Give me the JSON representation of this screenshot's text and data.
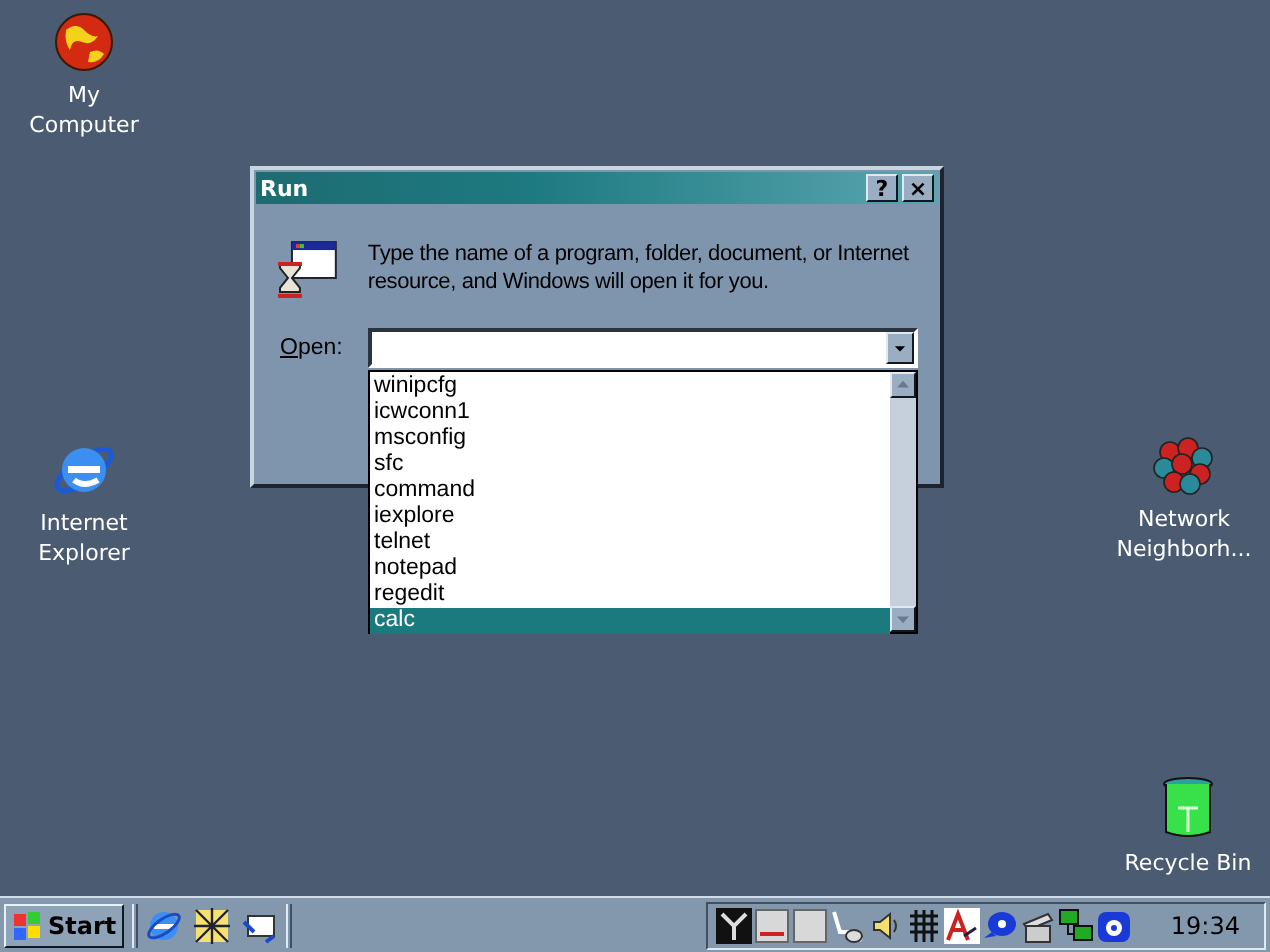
{
  "desktop_icons": [
    {
      "label": "My Computer",
      "kind": "globe"
    },
    {
      "label": "Internet Explorer",
      "kind": "ie"
    },
    {
      "label": "Network Neighborh...",
      "kind": "cluster"
    },
    {
      "label": "Recycle Bin",
      "kind": "beaker"
    }
  ],
  "window": {
    "title": "Run",
    "message": "Type the name of a program, folder, document, or Internet resource, and Windows will open it for you.",
    "help_button": "?",
    "close_button": "×",
    "open_label": "Open:",
    "dropdown_items": [
      {
        "label": "winipcfg",
        "selected": false
      },
      {
        "label": "icwconn1",
        "selected": false
      },
      {
        "label": "msconfig",
        "selected": false
      },
      {
        "label": "sfc",
        "selected": false
      },
      {
        "label": "command",
        "selected": false
      },
      {
        "label": "iexplore",
        "selected": false
      },
      {
        "label": "telnet",
        "selected": false
      },
      {
        "label": "notepad",
        "selected": false
      },
      {
        "label": "regedit",
        "selected": false
      },
      {
        "label": "calc",
        "selected": true
      }
    ]
  },
  "taskbar": {
    "start_label": "Start",
    "clock": "19:34"
  }
}
